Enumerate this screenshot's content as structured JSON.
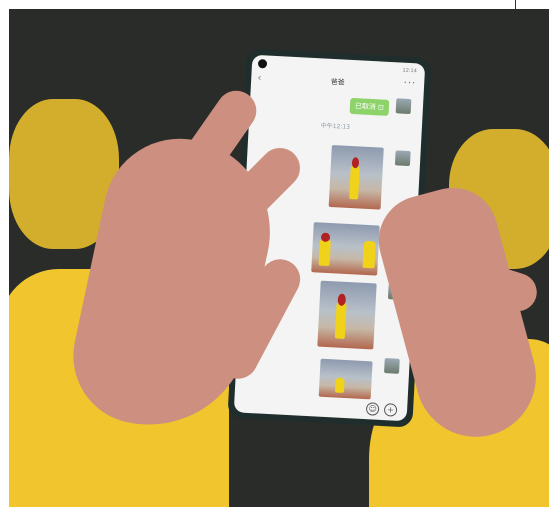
{
  "chat": {
    "contact_name": "爸爸",
    "cancelled_message": "已取消 ⊡",
    "timestamp": "中午12:13",
    "status_time": "12:14"
  },
  "icons": {
    "back": "chevron-left-icon",
    "more": "more-dots-icon",
    "emoji": "emoji-icon",
    "add": "plus-icon"
  },
  "colors": {
    "bubble": "#8ed36a",
    "sweater": "#f0c52d",
    "phone": "#1f2e2c"
  }
}
